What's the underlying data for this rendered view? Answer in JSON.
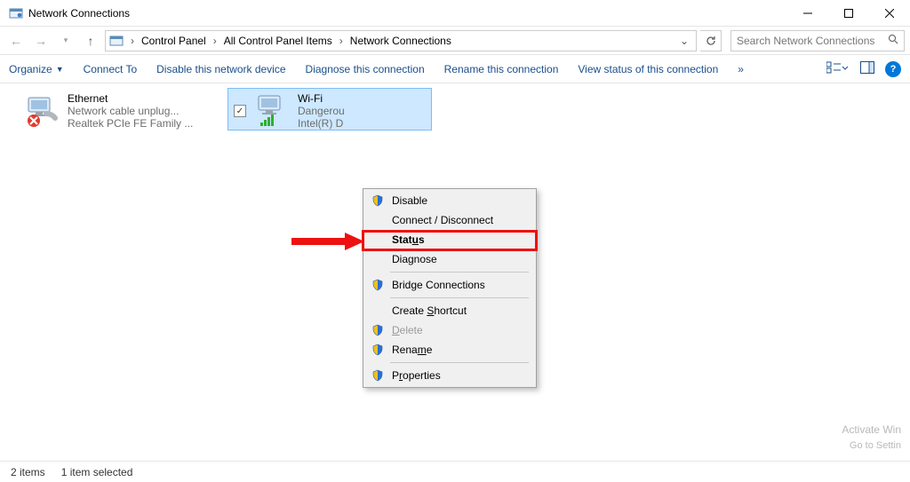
{
  "window": {
    "title": "Network Connections"
  },
  "address": {
    "segments": [
      "Control Panel",
      "All Control Panel Items",
      "Network Connections"
    ],
    "search_placeholder": "Search Network Connections"
  },
  "toolbar": {
    "organize": "Organize",
    "connect_to": "Connect To",
    "disable": "Disable this network device",
    "diagnose": "Diagnose this connection",
    "rename": "Rename this connection",
    "view_status": "View status of this connection",
    "overflow": "»"
  },
  "connections": {
    "ethernet": {
      "name": "Ethernet",
      "status": "Network cable unplug...",
      "adapter": "Realtek PCIe FE Family ..."
    },
    "wifi": {
      "name": "Wi-Fi",
      "status": "Dangerou",
      "adapter": "Intel(R) D"
    }
  },
  "context_menu": {
    "disable": "Disable",
    "connect": "Connect / Disconnect",
    "status": "Status",
    "diagnose": "Diagnose",
    "bridge": "Bridge Connections",
    "shortcut": "Create Shortcut",
    "delete": "Delete",
    "rename": "Rename",
    "properties": "Properties"
  },
  "statusbar": {
    "count": "2 items",
    "selected": "1 item selected"
  },
  "watermark": {
    "line1": "Activate Win",
    "line2": "Go to Settin"
  }
}
